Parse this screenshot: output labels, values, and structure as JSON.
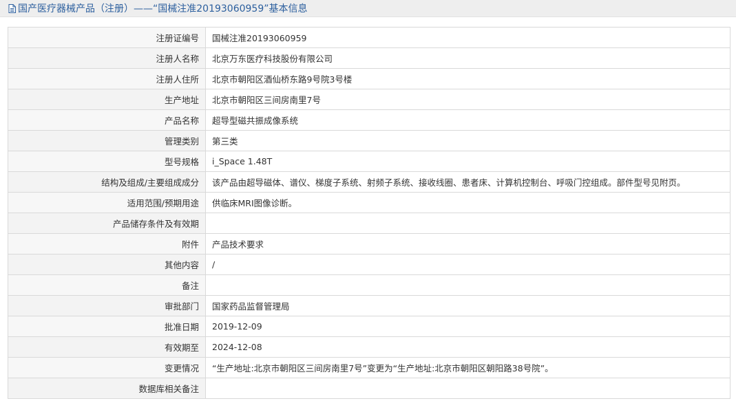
{
  "header": {
    "title": "国产医疗器械产品（注册）——“国械注准20193060959”基本信息",
    "icon": "document-icon",
    "title_color": "#2c5f9e"
  },
  "rows": [
    {
      "label": "注册证编号",
      "value": "国械注准20193060959"
    },
    {
      "label": "注册人名称",
      "value": "北京万东医疗科技股份有限公司"
    },
    {
      "label": "注册人住所",
      "value": "北京市朝阳区酒仙桥东路9号院3号楼"
    },
    {
      "label": "生产地址",
      "value": "北京市朝阳区三间房南里7号"
    },
    {
      "label": "产品名称",
      "value": "超导型磁共振成像系统"
    },
    {
      "label": "管理类别",
      "value": "第三类"
    },
    {
      "label": "型号规格",
      "value": "i_Space 1.48T"
    },
    {
      "label": "结构及组成/主要组成成分",
      "value": "该产品由超导磁体、谱仪、梯度子系统、射频子系统、接收线圈、患者床、计算机控制台、呼吸门控组成。部件型号见附页。"
    },
    {
      "label": "适用范围/预期用途",
      "value": "供临床MRI图像诊断。"
    },
    {
      "label": "产品储存条件及有效期",
      "value": ""
    },
    {
      "label": "附件",
      "value": "产品技术要求"
    },
    {
      "label": "其他内容",
      "value": "/"
    },
    {
      "label": "备注",
      "value": ""
    },
    {
      "label": "审批部门",
      "value": "国家药品监督管理局"
    },
    {
      "label": "批准日期",
      "value": "2019-12-09"
    },
    {
      "label": "有效期至",
      "value": "2024-12-08"
    },
    {
      "label": "变更情况",
      "value": "“生产地址:北京市朝阳区三间房南里7号”变更为“生产地址:北京市朝阳区朝阳路38号院”。"
    },
    {
      "label": "数据库相关备注",
      "value": ""
    }
  ]
}
